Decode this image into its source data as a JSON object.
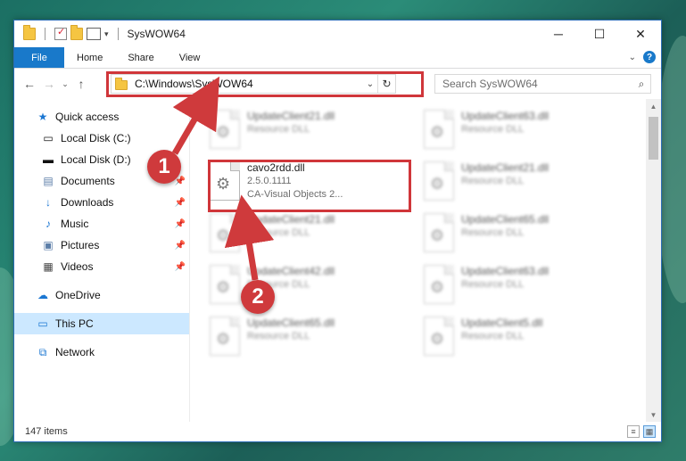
{
  "window": {
    "title": "SysWOW64",
    "controls": {
      "minimize": "─",
      "maximize": "☐",
      "close": "✕"
    }
  },
  "ribbon": {
    "tabs": [
      "File",
      "Home",
      "Share",
      "View"
    ],
    "help": "?"
  },
  "nav": {
    "address_path": "C:\\Windows\\SysWOW64",
    "search_placeholder": "Search SysWOW64"
  },
  "sidebar": {
    "items": [
      {
        "label": "Quick access",
        "icon": "star-icon"
      },
      {
        "label": "Local Disk (C:)",
        "icon": "drive-icon"
      },
      {
        "label": "Local Disk (D:)",
        "icon": "drive-icon"
      },
      {
        "label": "Documents",
        "icon": "documents-icon",
        "pinned": true
      },
      {
        "label": "Downloads",
        "icon": "download-icon",
        "pinned": true
      },
      {
        "label": "Music",
        "icon": "music-icon",
        "pinned": true
      },
      {
        "label": "Pictures",
        "icon": "pictures-icon",
        "pinned": true
      },
      {
        "label": "Videos",
        "icon": "videos-icon",
        "pinned": true
      },
      {
        "label": "OneDrive",
        "icon": "cloud-icon"
      },
      {
        "label": "This PC",
        "icon": "computer-icon"
      },
      {
        "label": "Network",
        "icon": "network-icon"
      }
    ]
  },
  "files": {
    "highlighted": {
      "name": "cavo2rdd.dll",
      "version": "2.5.0.1111",
      "description": "CA-Visual Objects 2..."
    },
    "blurred": [
      {
        "name": "UpdateClient21.dll",
        "type": "Resource DLL"
      },
      {
        "name": "UpdateClient63.dll",
        "type": "Resource DLL"
      },
      {
        "name": "UpdateClient21.dll",
        "type": "Resource DLL"
      },
      {
        "name": "UpdateClient21.dll",
        "type": "Resource DLL"
      },
      {
        "name": "UpdateClient65.dll",
        "type": "Resource DLL"
      },
      {
        "name": "UpdateClient42.dll",
        "type": "Resource DLL"
      },
      {
        "name": "UpdateClient63.dll",
        "type": "Resource DLL"
      },
      {
        "name": "UpdateClient65.dll",
        "type": "Resource DLL"
      },
      {
        "name": "UpdateClient5.dll",
        "type": "Resource DLL"
      }
    ]
  },
  "status": {
    "count": "147 items"
  },
  "annotations": {
    "step1": "1",
    "step2": "2",
    "color": "#cf3a3c"
  }
}
